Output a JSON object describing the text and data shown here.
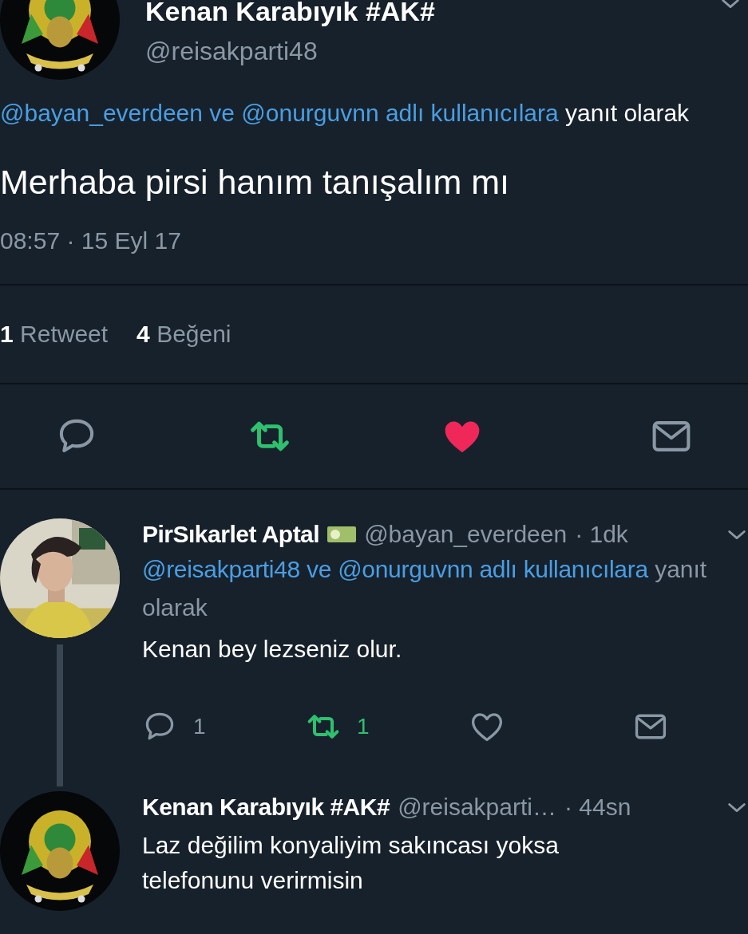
{
  "main_tweet": {
    "author": {
      "name": "Kenan Karabıyık #AK#",
      "handle": "@reisakparti48",
      "avatar": {
        "kind": "emblem"
      }
    },
    "reply_to": {
      "mentions": "@bayan_everdeen ve @onurguvnn adlı kullanıcılara",
      "suffix": "yanıt olarak"
    },
    "text": "Merhaba pirsi hanım tanışalım mı",
    "timestamp": "08:57 · 15 Eyl 17",
    "stats": [
      {
        "count": "1",
        "label": "Retweet"
      },
      {
        "count": "4",
        "label": "Beğeni"
      }
    ],
    "actions": {
      "retweeted": true,
      "liked": true
    }
  },
  "replies": [
    {
      "name": "PirSıkarlet Aptal",
      "handle": "@bayan_everdeen",
      "time": "· 1dk",
      "thread_line": true,
      "reply_to": {
        "mentions": "@reisakparti48 ve @onurguvnn adlı kullanıcılara",
        "suffix": "yanıt olarak"
      },
      "text": "Kenan bey lezseniz olur.",
      "actions": {
        "reply_count": "1",
        "retweet_count": "1",
        "retweeted": true,
        "liked": false
      }
    },
    {
      "name": "Kenan Karabıyık #AK#",
      "handle": "@reisakparti…",
      "time": "· 44sn",
      "avatar": {
        "kind": "emblem"
      },
      "thread_line": false,
      "text": "Laz değilim konyaliyim sakıncası yoksa telefonunu verirmisin"
    }
  ]
}
